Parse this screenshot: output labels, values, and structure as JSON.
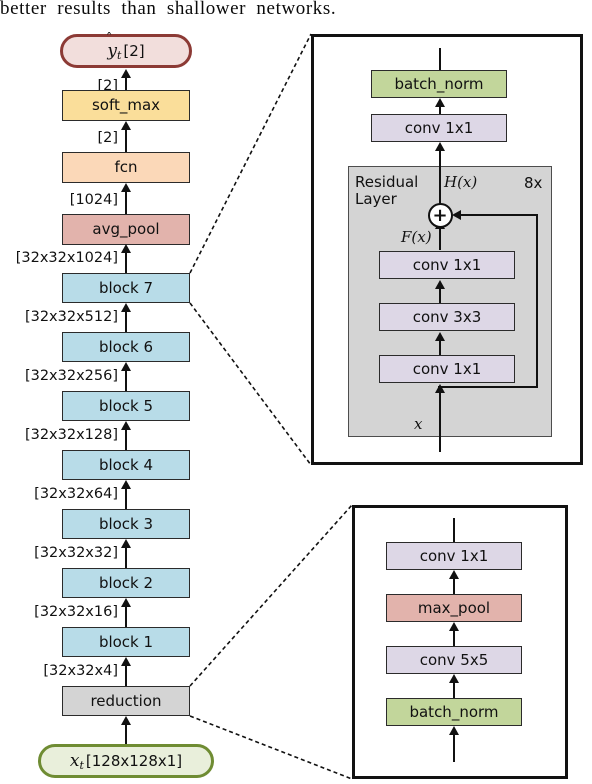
{
  "caption": "better results than shallower networks.",
  "colors": {
    "output_fill": "#f2dedc",
    "output_stroke": "#8c3a35",
    "softmax_fill": "#fade9a",
    "fcn_fill": "#fbd8b8",
    "avgpool_fill": "#e2b3ac",
    "block_fill": "#b8dce8",
    "reduction_fill": "#d4d4d4",
    "input_fill": "#e9efdb",
    "input_stroke": "#6f8c33",
    "conv_fill": "#ddd7e6",
    "batchnorm_fill": "#c2d69b",
    "maxpool_fill": "#e2b3ac",
    "residual_fill": "#d4d4d4",
    "stroke": "#2b2b2b"
  },
  "main_column": {
    "output_node": {
      "label_hat": "^",
      "label_var": "y",
      "label_sub": "t",
      "label_shape": "[2]",
      "name": "y_hat_t [2]"
    },
    "input_node": {
      "label_var": "x",
      "label_sub": "t",
      "label_shape": "[128x128x1]",
      "name": "x_t [128x128x1]"
    },
    "nodes": [
      {
        "label": "soft_max"
      },
      {
        "label": "fcn"
      },
      {
        "label": "avg_pool"
      },
      {
        "label": "block 7"
      },
      {
        "label": "block 6"
      },
      {
        "label": "block 5"
      },
      {
        "label": "block 4"
      },
      {
        "label": "block 3"
      },
      {
        "label": "block 2"
      },
      {
        "label": "block 1"
      },
      {
        "label": "reduction"
      }
    ],
    "edge_labels": [
      {
        "text": "[2]"
      },
      {
        "text": "[2]"
      },
      {
        "text": "[1024]"
      },
      {
        "text": "[32x32x1024]"
      },
      {
        "text": "[32x32x512]"
      },
      {
        "text": "[32x32x256]"
      },
      {
        "text": "[32x32x128]"
      },
      {
        "text": "[32x32x64]"
      },
      {
        "text": "[32x32x32]"
      },
      {
        "text": "[32x32x16]"
      },
      {
        "text": "[32x32x4]"
      }
    ]
  },
  "block_inset": {
    "title": "block detail",
    "top_nodes": [
      {
        "label": "batch_norm"
      },
      {
        "label": "conv 1x1"
      }
    ],
    "residual": {
      "label": "Residual\nLayer",
      "repeat": "8x",
      "h_of_x": "H(x)",
      "f_of_x": "F(x)",
      "x_label": "x",
      "plus": "+",
      "layers": [
        {
          "label": "conv 1x1"
        },
        {
          "label": "conv 3x3"
        },
        {
          "label": "conv 1x1"
        }
      ]
    }
  },
  "reduction_inset": {
    "title": "reduction detail",
    "nodes": [
      {
        "label": "conv 1x1"
      },
      {
        "label": "max_pool"
      },
      {
        "label": "conv 5x5"
      },
      {
        "label": "batch_norm"
      }
    ]
  }
}
